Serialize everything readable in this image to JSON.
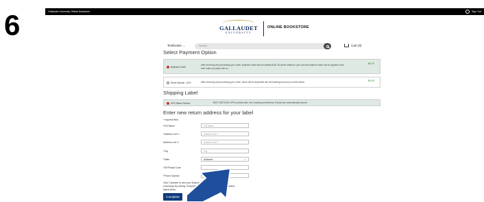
{
  "step_number": "6",
  "topbar": {
    "site_title": "Gallaudet University Official Bookstore",
    "signout_label": "Sign Out"
  },
  "header": {
    "logo_name": "GALLAUDET",
    "logo_sub": "UNIVERSITY",
    "store_name": "ONLINE BOOKSTORE"
  },
  "nav": {
    "textbooks_label": "Textbooks",
    "search_placeholder": "Search",
    "cart_label": "Cart (0)"
  },
  "payment": {
    "heading": "Select Payment Option",
    "options": [
      {
        "title": "Buyback Credit",
        "description": "After receiving and processing your order, Buyback credit with an additional $1.25 will be added to your account balance which can be applied to the next order you place with us.",
        "price": "$5.25",
        "selected": true
      },
      {
        "title": "Direct Deposit - ACH",
        "description": "After receiving and processing your order, funds will be deposited into the banking account you enter below.",
        "price": "$4.00",
        "selected": false
      }
    ]
  },
  "shipping": {
    "heading": "Shipping Label",
    "option_title": "UPS Return Service",
    "option_description": "BEST METHOD! UPS provides fast, free, tracking and delivery. Parcels are automatically insured."
  },
  "address": {
    "heading": "Enter new return address for your label",
    "required_note": "* required field",
    "fields": [
      {
        "label": "*Full Name",
        "placeholder": "Full Name"
      },
      {
        "label": "*Address Line 1",
        "placeholder": "Address Line 1"
      },
      {
        "label": "Address Line 2",
        "placeholder": "Address Line 2"
      },
      {
        "label": "*City",
        "placeholder": "City"
      }
    ],
    "state_label": "*State",
    "state_value": "Alabama",
    "zip_label": "*ZIP/Postal Code",
    "phone_label": "*Phone Number"
  },
  "notice": "Click 'Complete' to send your Buyback order to ekampus.com for processing. By clicking 'Complete', you agree to our Terms and Conditions stated below.",
  "complete_label": "Complete",
  "colors": {
    "arrow": "#1f4e9c",
    "button": "#0f3a7a",
    "selected_panel": "#dfe9e4",
    "price": "#2e7d32"
  }
}
